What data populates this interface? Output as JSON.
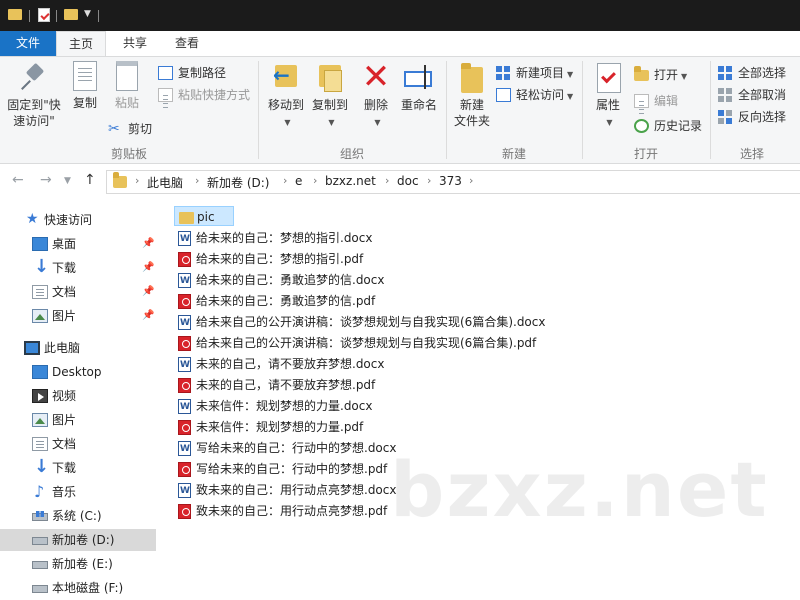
{
  "titlebar": {
    "quick_access": [
      "folder-icon",
      "properties-icon",
      "new-folder-icon"
    ]
  },
  "tabs": [
    {
      "label": "文件"
    },
    {
      "label": "主页"
    },
    {
      "label": "共享"
    },
    {
      "label": "查看"
    }
  ],
  "ribbon": {
    "clipboard": {
      "pin_label_1": "固定到\"快",
      "pin_label_2": "速访问\"",
      "copy": "复制",
      "paste": "粘贴",
      "copy_path": "复制路径",
      "paste_shortcut": "粘贴快捷方式",
      "cut": "剪切",
      "group": "剪贴板"
    },
    "organize": {
      "move_to": "移动到",
      "copy_to": "复制到",
      "delete": "删除",
      "rename": "重命名",
      "group": "组织"
    },
    "new": {
      "new_folder_1": "新建",
      "new_folder_2": "文件夹",
      "new_item": "新建项目",
      "easy_access": "轻松访问",
      "group": "新建"
    },
    "open": {
      "properties": "属性",
      "open": "打开",
      "edit": "编辑",
      "history": "历史记录",
      "group": "打开"
    },
    "select": {
      "select_all": "全部选择",
      "select_none": "全部取消",
      "invert": "反向选择",
      "group": "选择"
    }
  },
  "address": {
    "crumbs": [
      "此电脑",
      "新加卷 (D:)",
      "e",
      "bzxz.net",
      "doc",
      "373"
    ]
  },
  "nav": {
    "quick_access": "快速访问",
    "qa_items": [
      {
        "label": "桌面",
        "pinned": true
      },
      {
        "label": "下载",
        "pinned": true
      },
      {
        "label": "文档",
        "pinned": true
      },
      {
        "label": "图片",
        "pinned": true
      }
    ],
    "this_pc": "此电脑",
    "pc_items": [
      {
        "label": "Desktop"
      },
      {
        "label": "视频"
      },
      {
        "label": "图片"
      },
      {
        "label": "文档"
      },
      {
        "label": "下载"
      },
      {
        "label": "音乐"
      },
      {
        "label": "系统 (C:)"
      },
      {
        "label": "新加卷 (D:)",
        "selected": true
      },
      {
        "label": "新加卷 (E:)"
      },
      {
        "label": "本地磁盘 (F:)"
      }
    ]
  },
  "files": [
    {
      "name": "pic",
      "type": "folder",
      "selected": true
    },
    {
      "name": "给未来的自己：梦想的指引.docx",
      "type": "docx"
    },
    {
      "name": "给未来的自己：梦想的指引.pdf",
      "type": "pdf"
    },
    {
      "name": "给未来的自己：勇敢追梦的信.docx",
      "type": "docx"
    },
    {
      "name": "给未来的自己：勇敢追梦的信.pdf",
      "type": "pdf"
    },
    {
      "name": "给未来自己的公开演讲稿：谈梦想规划与自我实现(6篇合集).docx",
      "type": "docx"
    },
    {
      "name": "给未来自己的公开演讲稿：谈梦想规划与自我实现(6篇合集).pdf",
      "type": "pdf"
    },
    {
      "name": "未来的自己，请不要放弃梦想.docx",
      "type": "docx"
    },
    {
      "name": "未来的自己，请不要放弃梦想.pdf",
      "type": "pdf"
    },
    {
      "name": "未来信件：规划梦想的力量.docx",
      "type": "docx"
    },
    {
      "name": "未来信件：规划梦想的力量.pdf",
      "type": "pdf"
    },
    {
      "name": "写给未来的自己：行动中的梦想.docx",
      "type": "docx"
    },
    {
      "name": "写给未来的自己：行动中的梦想.pdf",
      "type": "pdf"
    },
    {
      "name": "致未来的自己：用行动点亮梦想.docx",
      "type": "docx"
    },
    {
      "name": "致未来的自己：用行动点亮梦想.pdf",
      "type": "pdf"
    }
  ],
  "watermark": "bzxz.net",
  "colors": {
    "accent": "#1a73c6",
    "selection": "#cce8ff",
    "ribbon_bg": "#f5f6f7"
  }
}
